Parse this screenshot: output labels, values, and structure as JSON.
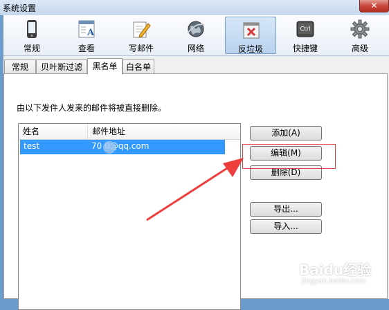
{
  "window": {
    "title": "系统设置",
    "close_label": "✕"
  },
  "toolbar": {
    "items": [
      {
        "label": "常规",
        "icon": "phone-icon"
      },
      {
        "label": "查看",
        "icon": "view-icon"
      },
      {
        "label": "写邮件",
        "icon": "compose-icon"
      },
      {
        "label": "网络",
        "icon": "globe-icon"
      },
      {
        "label": "反垃圾",
        "icon": "antispam-icon",
        "active": true
      },
      {
        "label": "快捷键",
        "icon": "ctrl-key-icon"
      },
      {
        "label": "高级",
        "icon": "gear-icon"
      }
    ],
    "ctrl_text": "Ctrl"
  },
  "tabs": [
    {
      "label": "常规"
    },
    {
      "label": "贝叶斯过滤"
    },
    {
      "label": "黑名单",
      "selected": true
    },
    {
      "label": "白名单"
    }
  ],
  "blacklist": {
    "description": "由以下发件人发来的邮件将被直接删除。",
    "columns": {
      "name": "姓名",
      "email": "邮件地址"
    },
    "rows": [
      {
        "name": "test",
        "email": "70    0@qq.com"
      }
    ],
    "buttons": {
      "add": "添加(A)",
      "edit": "编辑(M)",
      "delete": "删除(D)",
      "export": "导出...",
      "import": "导入..."
    }
  },
  "watermark": {
    "brand": "Baidu经验",
    "url": "jingyan.baidu.com"
  },
  "colors": {
    "selection": "#3399ff",
    "highlight": "#e04040"
  }
}
